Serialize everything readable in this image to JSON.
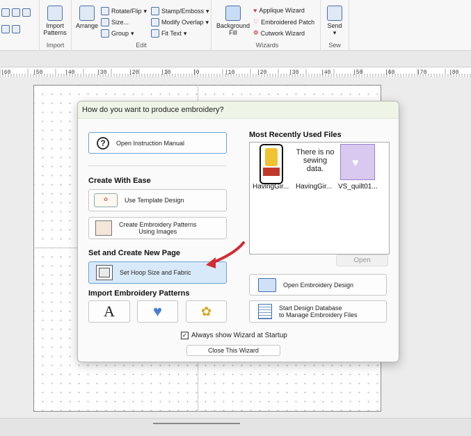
{
  "ribbon": {
    "import_group": {
      "label": "Import",
      "import_patterns": "Import\nPatterns"
    },
    "edit_group": {
      "label": "Edit",
      "rotate_flip": "Rotate/Flip",
      "size": "Size...",
      "group": "Group",
      "arrange": "Arrange",
      "stamp_emboss": "Stamp/Emboss",
      "modify_overlap": "Modify Overlap",
      "fit_text": "Fit Text"
    },
    "wizards_group": {
      "label": "Wizards",
      "background_fill": "Background\nFill",
      "applique_wizard": "Applique Wizard",
      "embroidered_patch": "Embroidered Patch",
      "cutwork_wizard": "Cutwork Wizard"
    },
    "sew_group": {
      "label": "Sew",
      "send": "Send"
    }
  },
  "ruler": {
    "labels": [
      "|60",
      "|50",
      "|40",
      "|30",
      "|20",
      "|10",
      "|0",
      "|10",
      "|20",
      "|30",
      "|40",
      "|50",
      "|60",
      "|70",
      "|80"
    ]
  },
  "dialog": {
    "title": "How do you want to produce embroidery?",
    "open_manual": "Open Instruction Manual",
    "create_with_ease_heading": "Create With Ease",
    "use_template": "Use Template Design",
    "create_from_images": "Create Embroidery Patterns\nUsing Images",
    "set_create_heading": "Set and Create New Page",
    "set_hoop": "Set Hoop Size and Fabric",
    "import_heading": "Import Embroidery Patterns",
    "mru_heading": "Most Recently Used Files",
    "mru_files": [
      {
        "caption": "HavingGir..."
      },
      {
        "caption": "HavingGir...",
        "placeholder": "There is no sewing data."
      },
      {
        "caption": "VS_quilt01..."
      }
    ],
    "open_button": "Open",
    "open_design": "Open Embroidery Design",
    "design_database": "Start Design Database\nto Manage Embroidery Files",
    "always_show": "Always show Wizard at Startup",
    "close_wizard": "Close This Wizard"
  },
  "colors": {
    "accent": "#6aa2d6",
    "arrow": "#d42a35",
    "title_bar": "#eef4e6"
  }
}
